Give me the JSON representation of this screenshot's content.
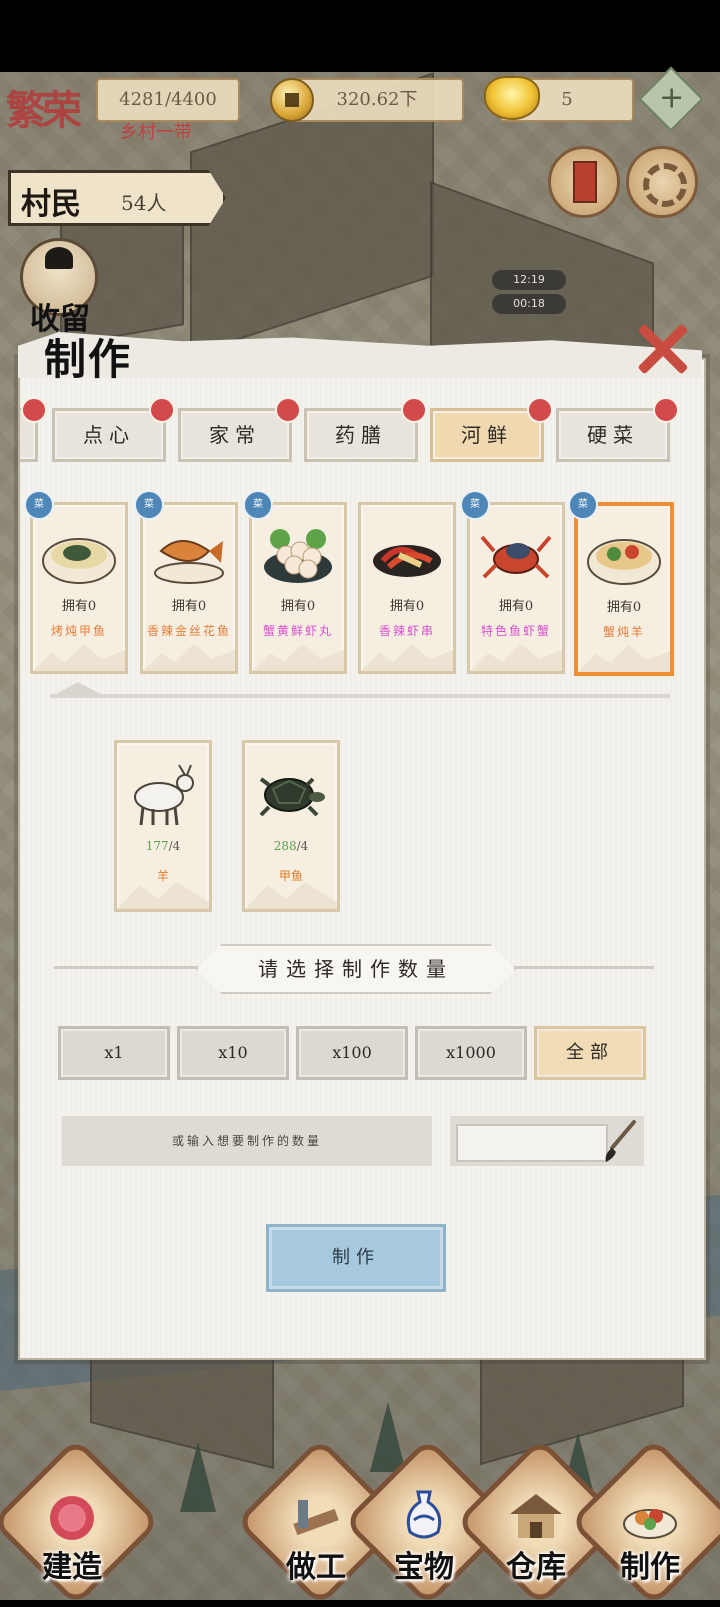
{
  "hud": {
    "progress_text": "4281/4400",
    "copper": "320.62下",
    "gold": "5",
    "plus_label": "+",
    "logo": "繁荣",
    "rank": "乡村一带"
  },
  "villagers": {
    "label": "村民",
    "count": "54人"
  },
  "timers": [
    "12:19",
    "00:18"
  ],
  "side_label": "收留",
  "dialog": {
    "title": "制作",
    "tabs": [
      {
        "label": "点心",
        "active": false
      },
      {
        "label": "家常",
        "active": false
      },
      {
        "label": "药膳",
        "active": false
      },
      {
        "label": "河鲜",
        "active": true
      },
      {
        "label": "硬菜",
        "active": false
      }
    ],
    "dishes": [
      {
        "owned": "拥有0",
        "name": "烤炖甲鱼",
        "name_color": "#e27d3a",
        "selected": false
      },
      {
        "owned": "拥有0",
        "name": "香辣金丝花鱼",
        "name_color": "#e27d3a",
        "selected": false
      },
      {
        "owned": "拥有0",
        "name": "蟹黄鲜虾丸",
        "name_color": "#d64fd0",
        "selected": false
      },
      {
        "owned": "拥有0",
        "name": "香辣虾串",
        "name_color": "#d64fd0",
        "selected": false
      },
      {
        "owned": "拥有0",
        "name": "特色鱼虾蟹",
        "name_color": "#d64fd0",
        "selected": false
      },
      {
        "owned": "拥有0",
        "name": "蟹炖羊",
        "name_color": "#e27d3a",
        "selected": true
      }
    ],
    "ingredients": [
      {
        "have": "177",
        "need": "/4",
        "name": "羊"
      },
      {
        "have": "288",
        "need": "/4",
        "name": "甲鱼"
      }
    ],
    "quantity_title": "请选择制作数量",
    "quantity_options": [
      "x1",
      "x10",
      "x100",
      "x1000",
      "全部"
    ],
    "custom_label": "或输入想要制作的数量",
    "custom_value": "",
    "make_button": "制作"
  },
  "nav": [
    {
      "label": "建造",
      "icon": "build-icon"
    },
    {
      "label": "做工",
      "icon": "work-icon"
    },
    {
      "label": "宝物",
      "icon": "treasure-icon"
    },
    {
      "label": "仓库",
      "icon": "warehouse-icon"
    },
    {
      "label": "制作",
      "icon": "craft-icon"
    }
  ]
}
